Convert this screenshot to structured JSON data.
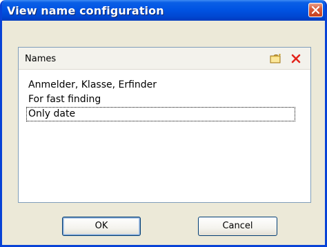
{
  "window": {
    "title": "View name configuration",
    "close_icon": "close-icon"
  },
  "names_panel": {
    "header_label": "Names",
    "add_icon": "folder-icon",
    "delete_icon": "delete-icon",
    "items": [
      {
        "label": "Anmelder, Klasse, Erfinder",
        "selected": false
      },
      {
        "label": "For fast finding",
        "selected": false
      },
      {
        "label": "Only date",
        "selected": true
      }
    ]
  },
  "buttons": {
    "ok_label": "OK",
    "cancel_label": "Cancel"
  },
  "colors": {
    "titlebar": "#0054e3",
    "frame_border": "#0842d6",
    "dialog_bg": "#ece9d8",
    "close_button": "#d95b3a"
  }
}
